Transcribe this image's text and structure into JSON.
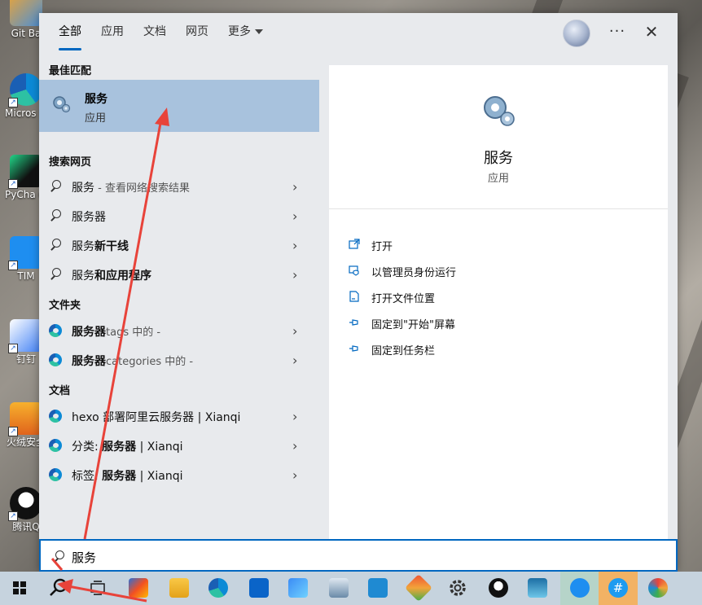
{
  "desktop": {
    "icons": [
      {
        "label": "Git Ba",
        "name": "git-bash"
      },
      {
        "label": "Micros Edge",
        "name": "edge"
      },
      {
        "label": "PyCha Commu",
        "name": "pycharm"
      },
      {
        "label": "TIM",
        "name": "tim"
      },
      {
        "label": "钉钉",
        "name": "dingtalk"
      },
      {
        "label": "火绒安全",
        "name": "huorong"
      },
      {
        "label": "腾讯Q",
        "name": "qq"
      }
    ]
  },
  "search": {
    "tabs": [
      {
        "label": "全部",
        "active": true
      },
      {
        "label": "应用"
      },
      {
        "label": "文档"
      },
      {
        "label": "网页"
      },
      {
        "label": "更多"
      }
    ],
    "more_icon": "···",
    "close_icon": "✕",
    "best_match": {
      "heading": "最佳匹配",
      "title": "服务",
      "subtitle": "应用"
    },
    "web": {
      "heading": "搜索网页",
      "items": [
        {
          "bold": "服务",
          "sub": " - 查看网络搜索结果",
          "tail": ""
        },
        {
          "bold": "服务器",
          "sub": "",
          "tail": ""
        },
        {
          "bold": "服务",
          "sub": "",
          "tail": "新干线"
        },
        {
          "bold": "服务",
          "sub": "",
          "tail": "和应用程序"
        }
      ]
    },
    "folders": {
      "heading": "文件夹",
      "items": [
        {
          "bold": "服务器",
          "sub": "tags 中的 -"
        },
        {
          "bold": "服务器",
          "sub": "categories 中的 -"
        }
      ]
    },
    "docs": {
      "heading": "文档",
      "items": [
        {
          "pre": "hexo 部署阿里云",
          "bold": "服务器",
          "post": " | Xianqi"
        },
        {
          "pre": "分类: ",
          "bold": "服务器",
          "post": " | Xianqi"
        },
        {
          "pre": "标签: ",
          "bold": "服务器",
          "post": " | Xianqi"
        }
      ]
    },
    "detail": {
      "title": "服务",
      "subtitle": "应用",
      "actions": [
        {
          "label": "打开",
          "icon": "open-icon"
        },
        {
          "label": "以管理员身份运行",
          "icon": "admin-icon"
        },
        {
          "label": "打开文件位置",
          "icon": "folder-location-icon"
        },
        {
          "label": "固定到\"开始\"屏幕",
          "icon": "pin-icon"
        },
        {
          "label": "固定到任务栏",
          "icon": "pin-taskbar-icon"
        }
      ]
    },
    "query": "服务"
  },
  "taskbar": {
    "items": [
      "start",
      "search",
      "task-view",
      "store",
      "file-explorer",
      "edge",
      "outlook-preview",
      "feishu",
      "performance-monitor",
      "vscode",
      "git-tool",
      "settings",
      "qq",
      "terminal-app",
      "tim-app",
      "hash-app",
      "paint-app"
    ]
  },
  "colors": {
    "accent": "#0067c0",
    "selection": "#a8c2dd",
    "annotation": "#e8433a"
  }
}
